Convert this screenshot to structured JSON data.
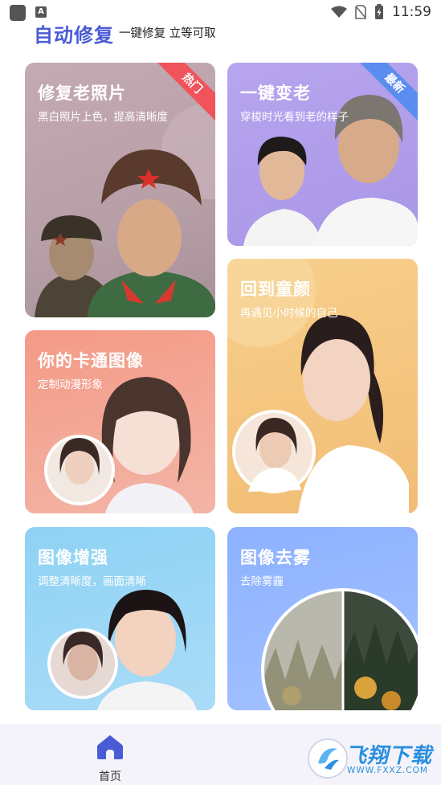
{
  "status_bar": {
    "time": "11:59",
    "left_icons": [
      "app-icon",
      "a-notification-icon"
    ],
    "right_icons": [
      "wifi-icon",
      "no-sim-icon",
      "battery-charging-icon"
    ]
  },
  "header": {
    "title": "自动修复",
    "subtitle": "一键修复 立等可取"
  },
  "cards": [
    {
      "id": "old_photo",
      "title": "修复老照片",
      "desc": "黑白照片上色，提高清晰度",
      "badge": "热门"
    },
    {
      "id": "aging",
      "title": "一键变老",
      "desc": "穿梭时光看到老的样子",
      "badge": "最新"
    },
    {
      "id": "childhood",
      "title": "回到童颜",
      "desc": "再遇见小时候的自己"
    },
    {
      "id": "cartoon",
      "title": "你的卡通图像",
      "desc": "定制动漫形象"
    },
    {
      "id": "enhance",
      "title": "图像增强",
      "desc": "调整清晰度，画面清晰"
    },
    {
      "id": "dehaze",
      "title": "图像去雾",
      "desc": "去除雾霾"
    }
  ],
  "bottom_nav": {
    "home_label": "首页",
    "home_icon": "home-icon",
    "accent": "#4a5bd6"
  },
  "watermark": {
    "text": "飞翔下载",
    "url": "WWW.FXXZ.COM"
  },
  "colors": {
    "title": "#4a5bd6",
    "hot_badge": "#f0535a",
    "new_badge": "#5b8df0"
  }
}
